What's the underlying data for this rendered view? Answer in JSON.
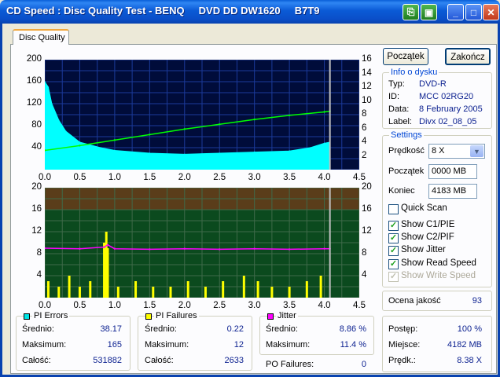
{
  "window": {
    "title": "CD Speed : Disc Quality Test - BENQ     DVD DD DW1620     B7T9"
  },
  "tabs": [
    {
      "label": "Disc Quality"
    }
  ],
  "buttons": {
    "start": "Początek",
    "stop": "Zakończ"
  },
  "disc_info": {
    "title": "Info o dysku",
    "type_label": "Typ:",
    "type_value": "DVD-R",
    "id_label": "ID:",
    "id_value": "MCC 02RG20",
    "date_label": "Data:",
    "date_value": "8 February 2005",
    "label_label": "Label:",
    "label_value": "Divx 02_08_05"
  },
  "settings": {
    "title": "Settings",
    "speed_label": "Prędkość",
    "speed_value": "8 X",
    "start_label": "Początek",
    "start_value": "0000 MB",
    "end_label": "Koniec",
    "end_value": "4183 MB",
    "quick_scan": "Quick Scan",
    "show_c1": "Show C1/PIE",
    "show_c2": "Show C2/PIF",
    "show_jitter": "Show Jitter",
    "show_read_speed": "Show Read Speed",
    "show_write_speed": "Show Write Speed"
  },
  "quality": {
    "label": "Ocena jakość",
    "value": "93"
  },
  "progress": {
    "progress_label": "Postęp:",
    "progress_value": "100 %",
    "position_label": "Miejsce:",
    "position_value": "4182 MB",
    "speed_label": "Prędk.:",
    "speed_value": "8.38 X"
  },
  "pi_errors": {
    "title": "PI Errors",
    "color": "#00e5e5",
    "avg_label": "Średnio:",
    "avg_value": "38.17",
    "max_label": "Maksimum:",
    "max_value": "165",
    "total_label": "Całość:",
    "total_value": "531882"
  },
  "pi_failures": {
    "title": "PI Failures",
    "color": "#ffff00",
    "avg_label": "Średnio:",
    "avg_value": "0.22",
    "max_label": "Maksimum:",
    "max_value": "12",
    "total_label": "Całość:",
    "total_value": "2633"
  },
  "jitter": {
    "title": "Jitter",
    "color": "#ff00ff",
    "avg_label": "Średnio:",
    "avg_value": "8.86 %",
    "max_label": "Maksimum:",
    "max_value": "11.4 %"
  },
  "po_failures": {
    "label": "PO Failures:",
    "value": "0"
  },
  "chart_data": [
    {
      "type": "area",
      "x_ticks": [
        "0.0",
        "0.5",
        "1.0",
        "1.5",
        "2.0",
        "2.5",
        "3.0",
        "3.5",
        "4.0",
        "4.5"
      ],
      "y_left_ticks": [
        "200",
        "160",
        "120",
        "80",
        "40"
      ],
      "y_right_ticks": [
        "16",
        "14",
        "12",
        "10",
        "8",
        "6",
        "4",
        "2"
      ],
      "xlim": [
        0,
        4.5
      ],
      "ylim_left": [
        0,
        200
      ],
      "ylim_right": [
        0,
        16
      ],
      "series": [
        {
          "color": "#00ffff",
          "x": [
            0,
            0.05,
            0.1,
            0.2,
            0.3,
            0.5,
            0.8,
            1.0,
            1.5,
            2.0,
            2.5,
            3.0,
            3.5,
            3.8,
            4.0,
            4.08
          ],
          "values": [
            160,
            150,
            120,
            90,
            70,
            50,
            40,
            35,
            30,
            28,
            30,
            32,
            34,
            40,
            48,
            50
          ]
        },
        {
          "color": "#00ff00",
          "x": [
            0,
            0.5,
            1.0,
            1.5,
            2.0,
            2.5,
            3.0,
            3.5,
            4.0,
            4.08
          ],
          "values": [
            2.8,
            3.5,
            4.3,
            5.1,
            5.9,
            6.6,
            7.3,
            7.9,
            8.4,
            8.5
          ]
        }
      ],
      "grid": true
    },
    {
      "type": "bar",
      "x_ticks": [
        "0.0",
        "0.5",
        "1.0",
        "1.5",
        "2.0",
        "2.5",
        "3.0",
        "3.5",
        "4.0",
        "4.5"
      ],
      "y_left_ticks": [
        "20",
        "16",
        "12",
        "8",
        "4"
      ],
      "y_right_ticks": [
        "20",
        "16",
        "12",
        "8",
        "4"
      ],
      "xlim": [
        0,
        4.5
      ],
      "ylim_left": [
        0,
        20
      ],
      "ylim_right": [
        0,
        20
      ],
      "series": [
        {
          "color": "#ffff00",
          "x": [
            0.05,
            0.2,
            0.35,
            0.5,
            0.65,
            0.85,
            0.88,
            0.9,
            1.05,
            1.3,
            1.55,
            1.8,
            2.05,
            2.3,
            2.55,
            2.85,
            3.05,
            3.25,
            3.5,
            3.75,
            3.95
          ],
          "values": [
            3,
            2,
            4,
            2,
            3,
            10,
            12,
            9,
            2,
            3,
            2,
            2,
            3,
            2,
            3,
            4,
            3,
            2,
            2,
            3,
            4
          ]
        },
        {
          "color": "#ff00ff",
          "x": [
            0,
            0.5,
            0.85,
            0.9,
            1.0,
            1.5,
            2.0,
            2.5,
            3.0,
            3.5,
            4.0,
            4.08
          ],
          "values": [
            9.0,
            8.9,
            9.2,
            9.6,
            8.9,
            8.8,
            8.9,
            8.8,
            8.9,
            8.8,
            8.9,
            8.9
          ]
        }
      ],
      "grid": true
    }
  ]
}
